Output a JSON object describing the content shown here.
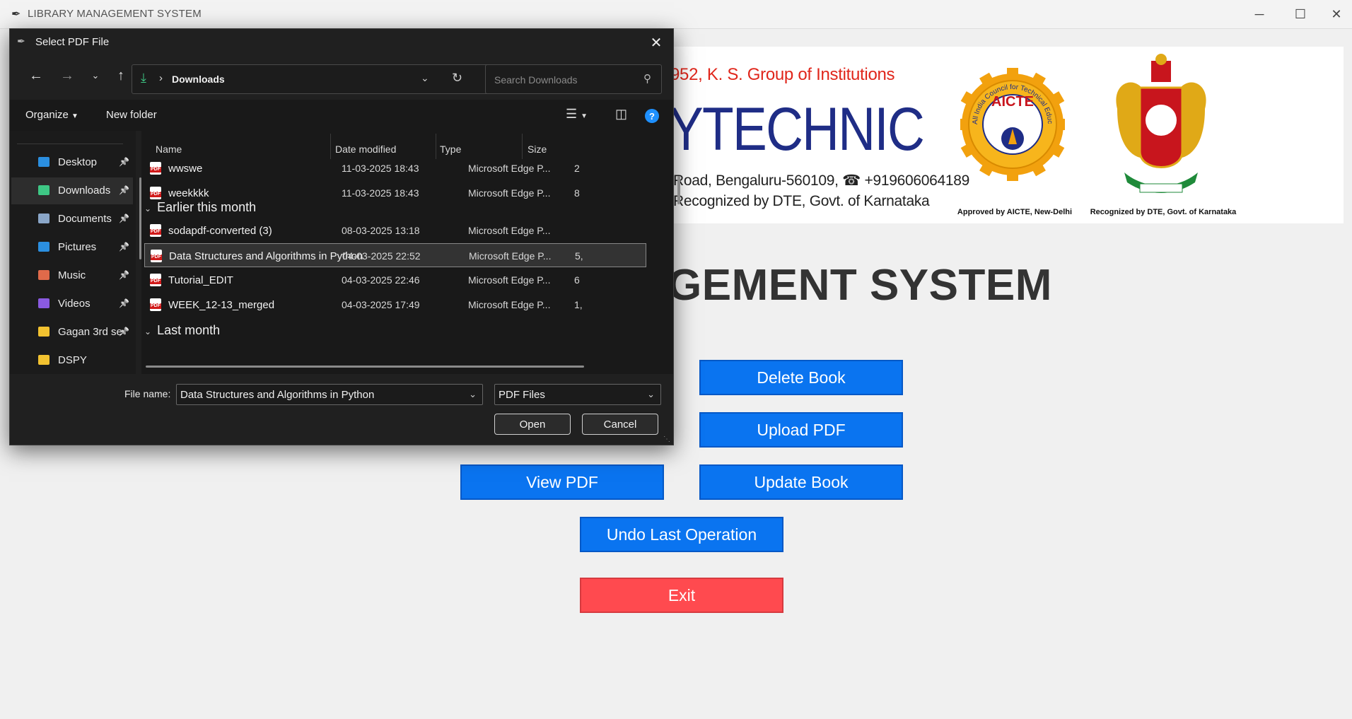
{
  "app": {
    "title": "LIBRARY MANAGEMENT SYSTEM",
    "window_controls": {
      "minimize": "─",
      "maximize": "☐",
      "close": "✕"
    }
  },
  "banner": {
    "line1": "952, K. S. Group of Institutions",
    "big": "YTECHNIC",
    "line3": "Road, Bengaluru-560109, ☎ +919606064189",
    "line4": "Recognized by DTE, Govt. of Karnataka",
    "aicte_caption": "Approved by AICTE, New-Delhi",
    "aicte_logo_text": "AICTE",
    "aicte_ring_text": "All India Council for Technical Education",
    "ka_caption": "Recognized by DTE, Govt. of Karnataka"
  },
  "heading": "GEMENT SYSTEM",
  "buttons": {
    "delete": "Delete Book",
    "upload": "Upload PDF",
    "view": "View PDF",
    "update": "Update Book",
    "undo": "Undo Last Operation",
    "exit": "Exit"
  },
  "colors": {
    "primary": "#0a74f0",
    "danger": "#ff4a4f",
    "dialog_bg": "#202020"
  },
  "dialog": {
    "title": "Select PDF File",
    "address": {
      "location": "Downloads"
    },
    "search_placeholder": "Search Downloads",
    "commands": {
      "organize": "Organize",
      "new_folder": "New folder"
    },
    "sidebar": [
      {
        "label": "Desktop",
        "icon": "desktop-icon",
        "color": "#2b8fe0",
        "pinned": true
      },
      {
        "label": "Downloads",
        "icon": "download-icon",
        "color": "#3ec785",
        "pinned": true,
        "active": true
      },
      {
        "label": "Documents",
        "icon": "documents-icon",
        "color": "#8aa6c8",
        "pinned": true
      },
      {
        "label": "Pictures",
        "icon": "pictures-icon",
        "color": "#2b8fe0",
        "pinned": true
      },
      {
        "label": "Music",
        "icon": "music-icon",
        "color": "#e06a4a",
        "pinned": true
      },
      {
        "label": "Videos",
        "icon": "videos-icon",
        "color": "#8a5ae0",
        "pinned": true
      },
      {
        "label": "Gagan 3rd se",
        "icon": "folder-icon",
        "color": "#f2c230",
        "pinned": true
      },
      {
        "label": "DSPY",
        "icon": "folder-icon",
        "color": "#f2c230",
        "pinned": false
      }
    ],
    "columns": {
      "name": "Name",
      "date": "Date modified",
      "type": "Type",
      "size": "Size"
    },
    "groups": {
      "earlier": "Earlier this month",
      "last_month": "Last month"
    },
    "files_recent": [
      {
        "name": "wwswe",
        "date": "11-03-2025 18:43",
        "type": "Microsoft Edge P...",
        "size": "2"
      },
      {
        "name": "weekkkk",
        "date": "11-03-2025 18:43",
        "type": "Microsoft Edge P...",
        "size": "8"
      }
    ],
    "files_earlier": [
      {
        "name": "sodapdf-converted (3)",
        "date": "08-03-2025 13:18",
        "type": "Microsoft Edge P...",
        "size": ""
      },
      {
        "name": "Data Structures and Algorithms in Python",
        "date": "04-03-2025 22:52",
        "type": "Microsoft Edge P...",
        "size": "5,",
        "selected": true
      },
      {
        "name": "Tutorial_EDIT",
        "date": "04-03-2025 22:46",
        "type": "Microsoft Edge P...",
        "size": "6"
      },
      {
        "name": "WEEK_12-13_merged",
        "date": "04-03-2025 17:49",
        "type": "Microsoft Edge P...",
        "size": "1,"
      }
    ],
    "file_name_label": "File name:",
    "file_name_value": "Data Structures and Algorithms in Python",
    "file_type_value": "PDF Files",
    "open_label": "Open",
    "cancel_label": "Cancel"
  }
}
